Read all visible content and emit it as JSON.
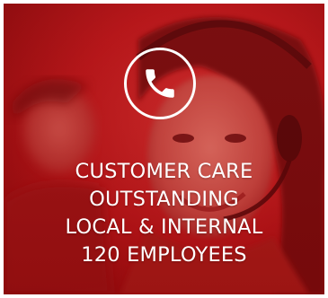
{
  "card": {
    "icon": "phone-icon",
    "lines": [
      "CUSTOMER CARE",
      "OUTSTANDING",
      "LOCAL & INTERNAL",
      "120 EMPLOYEES"
    ]
  },
  "colors": {
    "overlay_red": "#b51a1d",
    "text": "#ffffff"
  }
}
